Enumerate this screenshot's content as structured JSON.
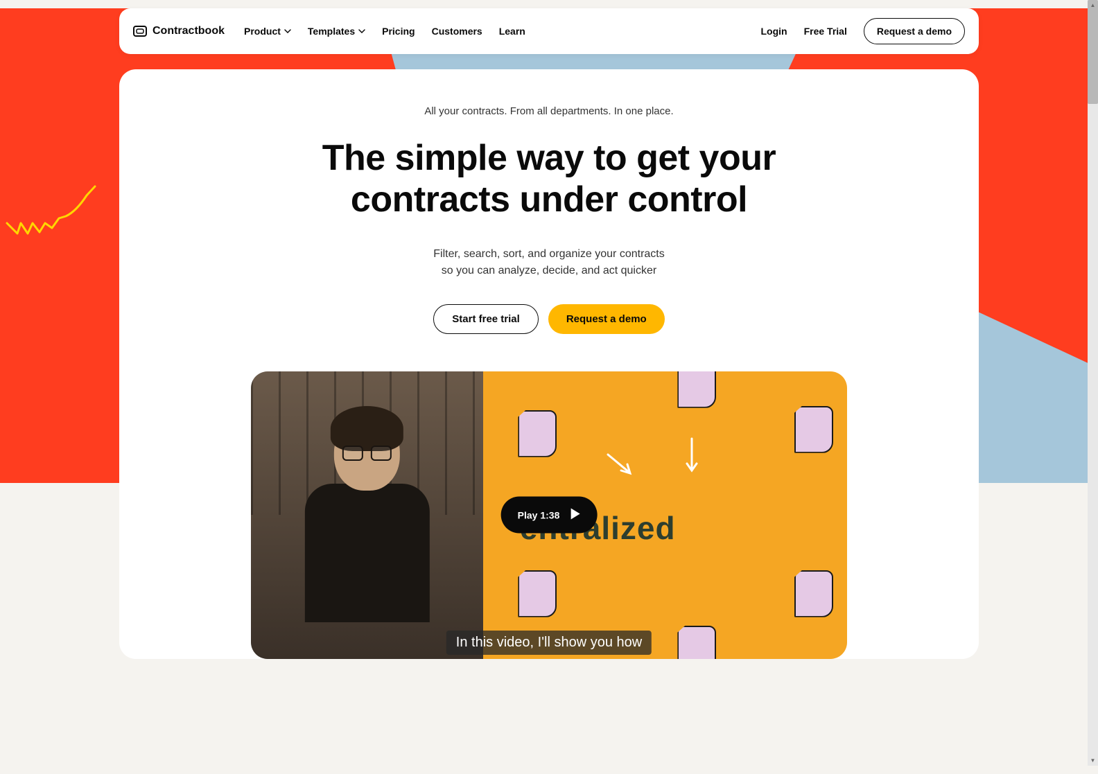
{
  "brand": {
    "name": "Contractbook"
  },
  "nav": {
    "items": [
      {
        "label": "Product",
        "hasDropdown": true
      },
      {
        "label": "Templates",
        "hasDropdown": true
      },
      {
        "label": "Pricing",
        "hasDropdown": false
      },
      {
        "label": "Customers",
        "hasDropdown": false
      },
      {
        "label": "Learn",
        "hasDropdown": false
      }
    ],
    "login": "Login",
    "freeTrial": "Free Trial",
    "requestDemo": "Request a demo"
  },
  "hero": {
    "tagline": "All your contracts. From all departments. In one place.",
    "title_line1": "The simple way to get your",
    "title_line2": "contracts under control",
    "subtitle_line1": "Filter, search, sort, and organize your contracts",
    "subtitle_line2": "so you can analyze, decide, and act quicker",
    "startTrial": "Start free trial",
    "requestDemo": "Request a demo"
  },
  "video": {
    "playLabel": "Play 1:38",
    "overlayText": "entralized",
    "caption": "In this video, I'll show you how"
  }
}
